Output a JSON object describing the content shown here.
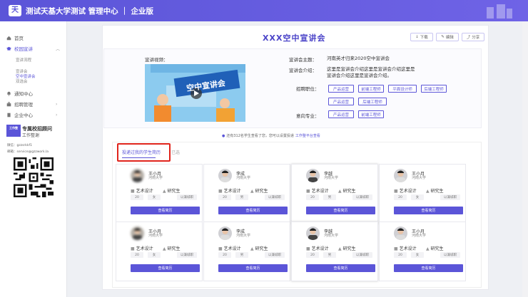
{
  "app": {
    "title": "测试天基大学测试 管理中心 ｜ 企业版",
    "logo_char": "天"
  },
  "sidebar": {
    "home": "首页",
    "campus": "校园宣讲",
    "campus_subs": [
      "宣讲流程",
      "宣讲会",
      "空中宣讲会",
      "双选会"
    ],
    "notice_center": "通知中心",
    "recruit_mgmt": "招聘管理",
    "enterprise_center": "企业中心",
    "brand_logo": "工作整",
    "brand_name": "专属校招顾问",
    "brand_sub": "工作整谢",
    "wechat": "微信：gzzsrkkf1",
    "email": "邮箱：service@gzzwork.la"
  },
  "page": {
    "title": "XXX空中宣讲会",
    "download": "下载",
    "edit": "编辑",
    "share": "分享"
  },
  "info": {
    "video_label": "宣讲视频：",
    "video_banner": "空中宣讲会",
    "theme_label": "宣讲会主题：",
    "theme_value": "河南英才归来2020空中宣讲会",
    "intro_label": "宣讲会介绍：",
    "intro_value_1": "这里是宣讲会介绍这里是宣讲会介绍这里是",
    "intro_value_2": "宣讲会介绍这里是宣讲会介绍。",
    "position_label": "招聘职位：",
    "positions": [
      "产品运营",
      "前端工程师",
      "平面设计师",
      "后端工程师",
      "产品运营",
      "后端工程师"
    ],
    "major_label": "意向专业：",
    "majors": [
      "产品运营",
      "前端工程师"
    ]
  },
  "notice": {
    "text": "还有312名学生查看了您，您可以设置投递",
    "link": "工作整平台查看"
  },
  "tabs": {
    "active": "投递过我的学生简历",
    "other": "已选"
  },
  "cards": [
    {
      "name": "王小月",
      "school": "河南大学",
      "major": "艺术设计",
      "degree": "研究生",
      "pills": [
        "20",
        "女",
        "以兼城职"
      ],
      "button": "查看简历"
    },
    {
      "name": "李成",
      "school": "河南大学",
      "major": "艺术设计",
      "degree": "研究生",
      "pills": [
        "20",
        "男",
        "以兼城职"
      ],
      "button": "查看简历"
    },
    {
      "name": "李越",
      "school": "河南大学",
      "major": "艺术设计",
      "degree": "研究生",
      "pills": [
        "20",
        "男",
        "以兼城职"
      ],
      "button": "查看简历"
    },
    {
      "name": "王小月",
      "school": "河南大学",
      "major": "艺术设计",
      "degree": "研究生",
      "pills": [
        "20",
        "女",
        "以兼城职"
      ],
      "button": "查看简历"
    },
    {
      "name": "王小月",
      "school": "河南大学",
      "major": "艺术设计",
      "degree": "研究生",
      "pills": [
        "20",
        "女",
        "以兼城职"
      ],
      "button": "查看简历"
    },
    {
      "name": "李成",
      "school": "河南大学",
      "major": "艺术设计",
      "degree": "研究生",
      "pills": [
        "20",
        "男",
        "以兼城职"
      ],
      "button": "查看简历"
    },
    {
      "name": "李越",
      "school": "河南大学",
      "major": "艺术设计",
      "degree": "研究生",
      "pills": [
        "20",
        "男",
        "以兼城职"
      ],
      "button": "查看简历"
    },
    {
      "name": "王小月",
      "school": "河南大学",
      "major": "艺术设计",
      "degree": "研究生",
      "pills": [
        "20",
        "女",
        "以兼城职"
      ],
      "button": "查看简历"
    }
  ],
  "colors": {
    "accent": "#5b55d8",
    "highlight": "#e0241c",
    "video_bg": "#7cc0ea"
  }
}
